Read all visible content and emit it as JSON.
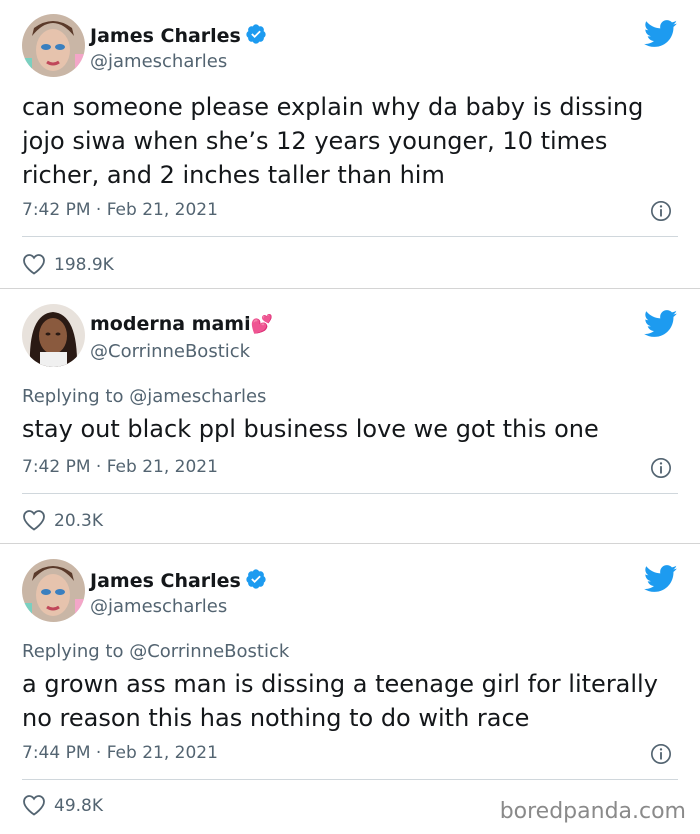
{
  "tweets": [
    {
      "name": "James Charles",
      "handle": "@jamescharles",
      "verified": true,
      "text": "can someone please explain why da baby is dissing jojo siwa when she’s 12 years younger, 10 times richer, and 2 inches taller than him",
      "timestamp": "7:42 PM · Feb 21, 2021",
      "likes": "198.9K"
    },
    {
      "name": "moderna mami",
      "name_emoji": "💕",
      "handle": "@CorrinneBostick",
      "reply_prefix": "Replying to",
      "reply_to": "@jamescharles",
      "text": "stay out black ppl business love we got this one",
      "timestamp": "7:42 PM · Feb 21, 2021",
      "likes": "20.3K"
    },
    {
      "name": "James Charles",
      "handle": "@jamescharles",
      "verified": true,
      "reply_prefix": "Replying to",
      "reply_to": "@CorrinneBostick",
      "text": "a grown ass man is dissing a teenage girl for literally no reason this has nothing to do with race",
      "timestamp": "7:44 PM · Feb 21, 2021",
      "likes": "49.8K"
    }
  ],
  "watermark": "boredpanda.com",
  "colors": {
    "twitter_blue": "#1d9bf0",
    "secondary_text": "#536471",
    "primary_text": "#14171a",
    "heart_emoji": "#e0245e"
  },
  "icons": [
    "twitter-bird-icon",
    "verified-badge-icon",
    "info-icon",
    "heart-icon"
  ]
}
